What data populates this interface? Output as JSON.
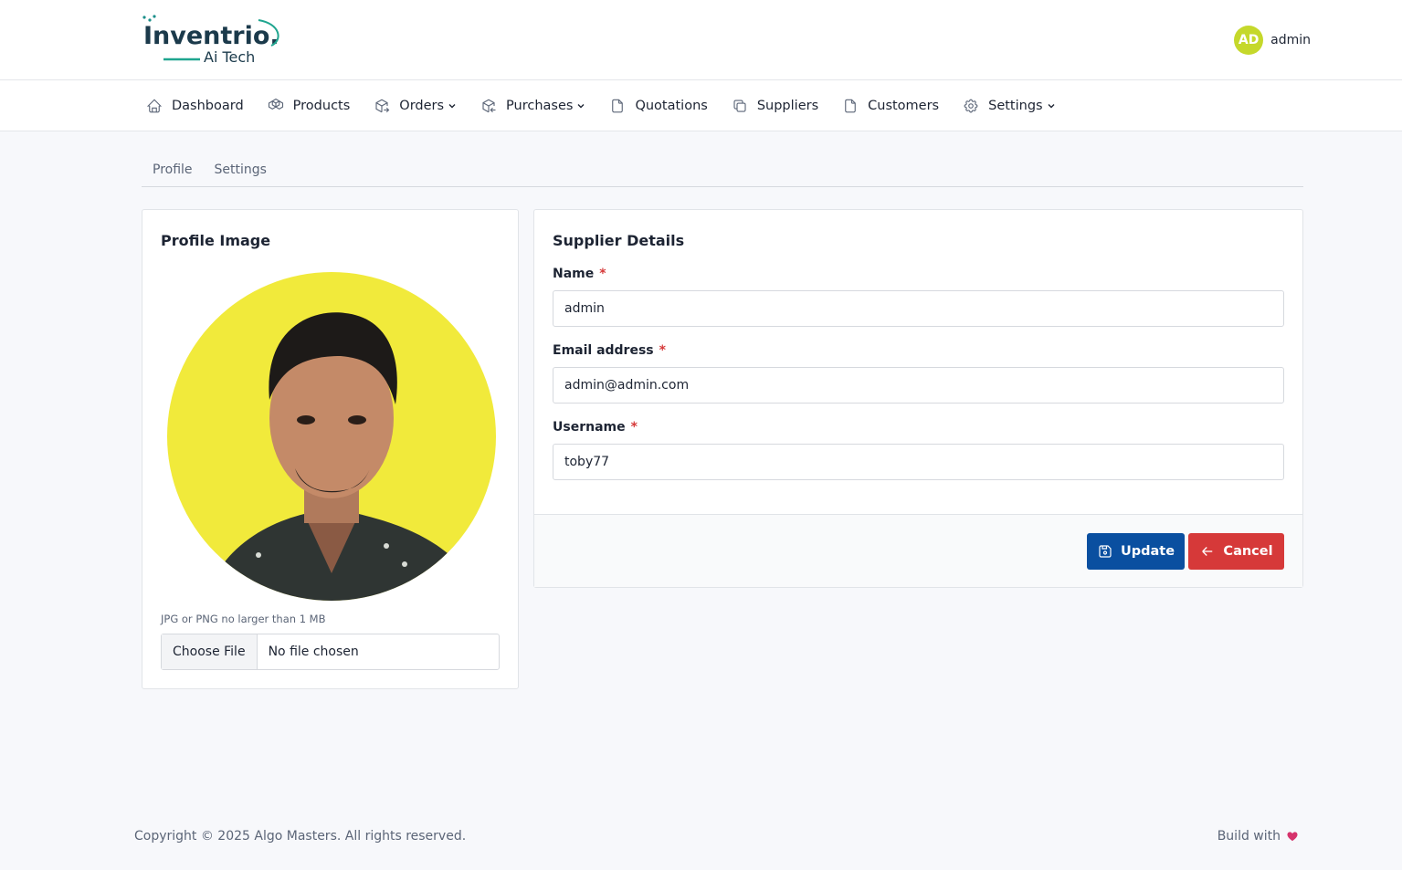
{
  "brand": {
    "logo_text": "Inventrio.",
    "logo_subtext": "Ai Tech",
    "logo_icon": "inventrio-logo"
  },
  "user": {
    "initials": "AD",
    "name": "admin",
    "avatar_color": "#c5d82b"
  },
  "nav": [
    {
      "label": "Dashboard",
      "icon": "home-icon"
    },
    {
      "label": "Products",
      "icon": "packages-icon"
    },
    {
      "label": "Orders",
      "icon": "package-export-icon",
      "dropdown": true
    },
    {
      "label": "Purchases",
      "icon": "package-import-icon",
      "dropdown": true
    },
    {
      "label": "Quotations",
      "icon": "file-icon"
    },
    {
      "label": "Suppliers",
      "icon": "copy-icon"
    },
    {
      "label": "Customers",
      "icon": "file-icon"
    },
    {
      "label": "Settings",
      "icon": "gear-icon",
      "dropdown": true
    }
  ],
  "tabs": [
    "Profile",
    "Settings"
  ],
  "profile_card": {
    "title": "Profile Image",
    "hint": "JPG or PNG no larger than 1 MB",
    "file_button": "Choose File",
    "file_status": "No file chosen",
    "photo_bg": "#f1ea3b"
  },
  "details_card": {
    "title": "Supplier Details",
    "fields": [
      {
        "label": "Name",
        "required": "*",
        "value": "admin"
      },
      {
        "label": "Email address",
        "required": "*",
        "value": "admin@admin.com"
      },
      {
        "label": "Username",
        "required": "*",
        "value": "toby77"
      }
    ],
    "update_label": "Update",
    "cancel_label": "Cancel",
    "update_color": "#0a4fa0",
    "cancel_color": "#d63939"
  },
  "footer": {
    "copyright": "Copyright © 2025 Algo Masters. All rights reserved.",
    "build_with": "Build with",
    "heart_icon": "heart-icon"
  }
}
